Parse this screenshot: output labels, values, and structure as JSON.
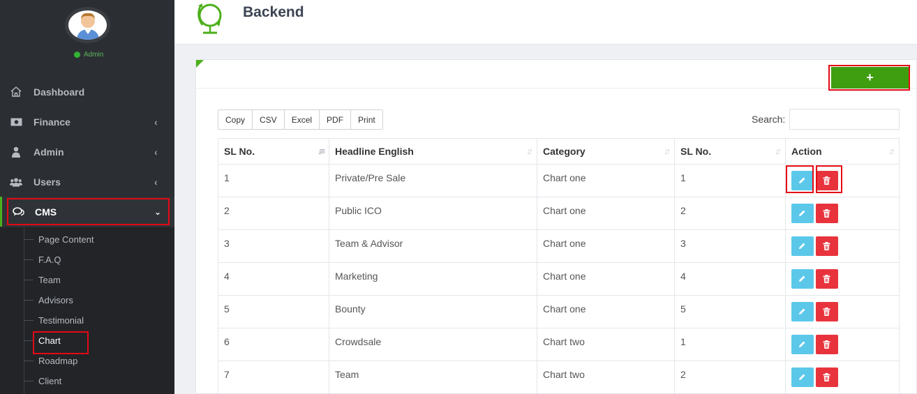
{
  "sidebar": {
    "user_status": "Admin",
    "nav": [
      {
        "label": "Dashboard",
        "icon": "home-icon",
        "has_chevron": false
      },
      {
        "label": "Finance",
        "icon": "money-icon",
        "has_chevron": true
      },
      {
        "label": "Admin",
        "icon": "user-lock-icon",
        "has_chevron": true
      },
      {
        "label": "Users",
        "icon": "users-icon",
        "has_chevron": true
      }
    ],
    "cms": {
      "label": "CMS",
      "icon": "comments-icon",
      "expanded": true
    },
    "submenu": [
      "Page Content",
      "F.A.Q",
      "Team",
      "Advisors",
      "Testimonial",
      "Chart",
      "Roadmap",
      "Client"
    ],
    "active_submenu": "Chart"
  },
  "header": {
    "title": "Backend"
  },
  "toolbar": {
    "add_label": "+",
    "export_buttons": [
      "Copy",
      "CSV",
      "Excel",
      "PDF",
      "Print"
    ],
    "search_label": "Search:",
    "search_value": ""
  },
  "table": {
    "columns": [
      "SL No.",
      "Headline English",
      "Category",
      "SL No.",
      "Action"
    ],
    "rows": [
      [
        "1",
        "Private/Pre Sale",
        "Chart one",
        "1"
      ],
      [
        "2",
        "Public ICO",
        "Chart one",
        "2"
      ],
      [
        "3",
        "Team & Advisor",
        "Chart one",
        "3"
      ],
      [
        "4",
        "Marketing",
        "Chart one",
        "4"
      ],
      [
        "5",
        "Bounty",
        "Chart one",
        "5"
      ],
      [
        "6",
        "Crowdsale",
        "Chart two",
        "1"
      ],
      [
        "7",
        "Team",
        "Chart two",
        "2"
      ]
    ]
  },
  "colors": {
    "sidebar_bg": "#2b2e33",
    "accent_green": "#3f9e10",
    "edit_button": "#5bc8ea",
    "delete_button": "#e8333d",
    "highlight_red": "#e50914"
  }
}
